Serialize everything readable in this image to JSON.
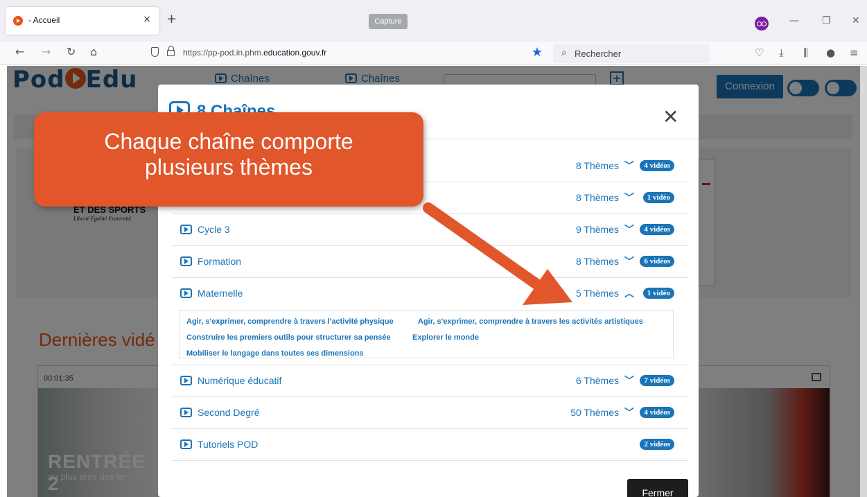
{
  "browser": {
    "tab_title": "- Accueil",
    "tab_close": "×",
    "new_tab": "+",
    "url_prefix": "https://pp-pod.in.phm.",
    "url_domain": "education.gouv.fr",
    "search_placeholder": "Rechercher",
    "capture_tooltip": "Capture"
  },
  "page": {
    "logo_left": "Pod",
    "logo_right": "Edu",
    "nav_link_1": "Chaînes",
    "nav_link_2": "Chaînes",
    "connexion": "Connexion",
    "institution": "ET DES SPORTS",
    "institution_motto": "Liberté Égalité Fraternité",
    "latest_videos_heading": "Dernières vidé",
    "video_duration": "00:01:35",
    "thumb_title": "RENTRÉE 2",
    "thumb_subtitle": "au plus près des ter"
  },
  "modal": {
    "title": "8 Chaînes",
    "close_label": "Fermer",
    "channels": [
      {
        "name": "",
        "themes": "8 Thèmes",
        "videos": "4 vidéos",
        "expanded": false
      },
      {
        "name": "",
        "themes": "8 Thèmes",
        "videos": "1 vidéo",
        "expanded": false
      },
      {
        "name": "Cycle 3",
        "themes": "9 Thèmes",
        "videos": "4 vidéos",
        "expanded": false
      },
      {
        "name": "Formation",
        "themes": "8 Thèmes",
        "videos": "6 vidéos",
        "expanded": false
      },
      {
        "name": "Maternelle",
        "themes": "5 Thèmes",
        "videos": "1 vidéo",
        "expanded": true,
        "theme_links": [
          "Agir, s'exprimer, comprendre à travers l'activité physique",
          "Agir, s'exprimer, comprendre à travers les activités artistiques",
          "Construire les premiers outils pour structurer sa pensée",
          "Explorer le monde",
          "Mobiliser le langage dans toutes ses dimensions"
        ]
      },
      {
        "name": "Numérique éducatif",
        "themes": "6 Thèmes",
        "videos": "7 vidéos",
        "expanded": false
      },
      {
        "name": "Second Degré",
        "themes": "50 Thèmes",
        "videos": "4 vidéos",
        "expanded": false
      },
      {
        "name": "Tutoriels POD",
        "themes": "",
        "videos": "2 vidéos",
        "expanded": false
      }
    ]
  },
  "callout": {
    "line1": "Chaque chaîne comporte",
    "line2": "plusieurs thèmes"
  },
  "colors": {
    "accent": "#1b74b8",
    "callout": "#e1562a",
    "brand_orange": "#e8541a"
  }
}
